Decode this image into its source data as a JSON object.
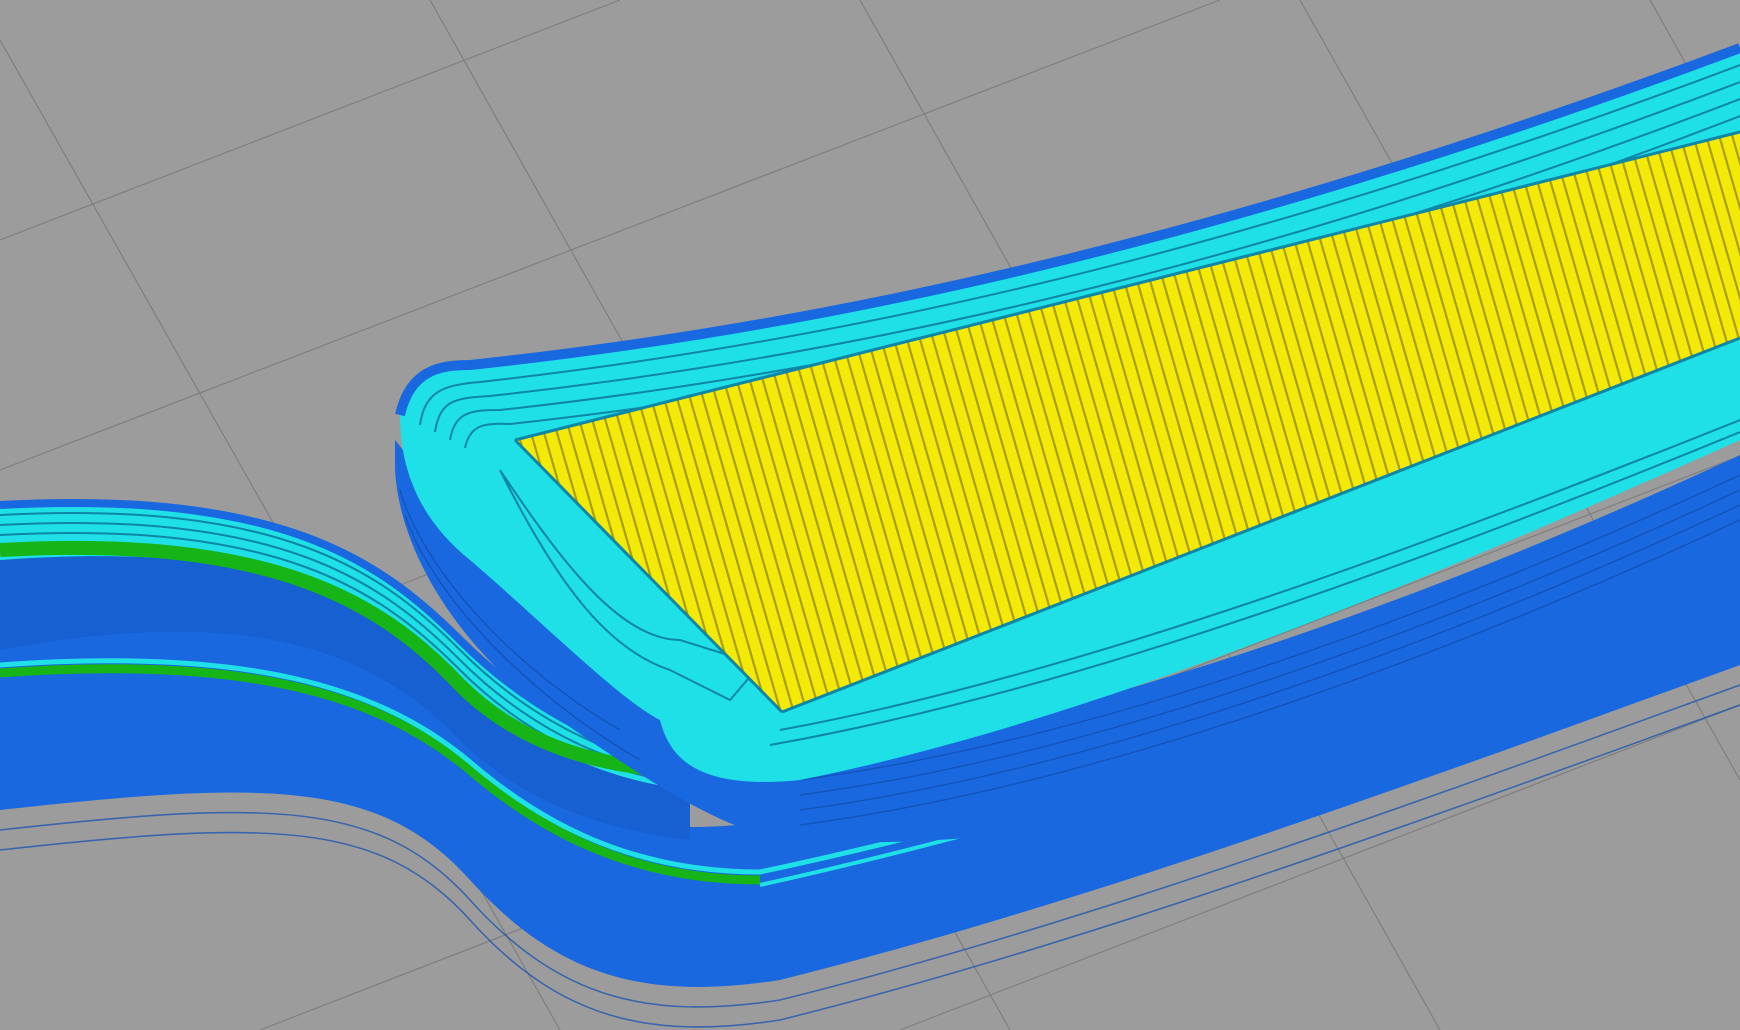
{
  "viewport": {
    "view": "gcode-preview",
    "background_color": "#9c9c9c",
    "grid_color": "#7a7a7a"
  },
  "toolpaths": {
    "external_perimeter": {
      "color": "#1a68e0"
    },
    "perimeter": {
      "color": "#1fe0e6"
    },
    "overhang_perimeter": {
      "color": "#16b416"
    },
    "solid_infill": {
      "color": "#f4ea0a"
    }
  }
}
